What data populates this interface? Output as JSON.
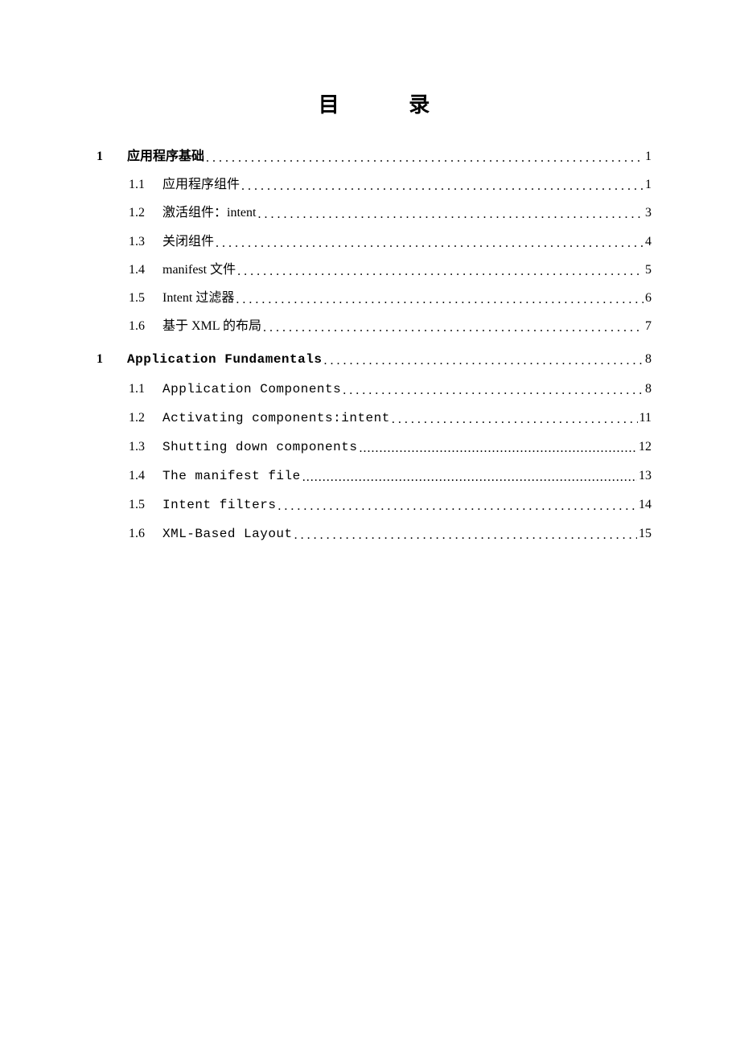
{
  "title": "目 录",
  "sections": [
    {
      "num": "1",
      "title": "应用程序基础",
      "page": "1",
      "mono": false,
      "items": [
        {
          "num": "1.1",
          "title": "应用程序组件",
          "page": "1",
          "mono": false,
          "tight": false
        },
        {
          "num": "1.2",
          "title": "激活组件：intent",
          "page": "3",
          "mono": false,
          "tight": false
        },
        {
          "num": "1.3",
          "title": "关闭组件",
          "page": "4",
          "mono": false,
          "tight": false
        },
        {
          "num": "1.4",
          "title": "manifest 文件",
          "page": "5",
          "mono": false,
          "tight": false
        },
        {
          "num": "1.5",
          "title": "Intent 过滤器",
          "page": "6",
          "mono": false,
          "tight": false
        },
        {
          "num": "1.6",
          "title": "基于 XML 的布局",
          "page": "7",
          "mono": false,
          "tight": false
        }
      ]
    },
    {
      "num": "1",
      "title": "Application Fundamentals ",
      "page": "8",
      "mono": true,
      "items": [
        {
          "num": "1.1",
          "title": "Application Components",
          "page": "8",
          "mono": true,
          "tight": false
        },
        {
          "num": "1.2",
          "title": "Activating components:intent",
          "page": "11",
          "mono": true,
          "tight": false
        },
        {
          "num": "1.3",
          "title": "Shutting down components",
          "page": "12",
          "mono": true,
          "tight": true
        },
        {
          "num": "1.4",
          "title": "The manifest file",
          "page": "13",
          "mono": true,
          "tight": true
        },
        {
          "num": "1.5",
          "title": "Intent filters",
          "page": "14",
          "mono": true,
          "tight": false
        },
        {
          "num": "1.6",
          "title": "XML-Based Layout",
          "page": "15",
          "mono": true,
          "tight": false
        }
      ]
    }
  ]
}
